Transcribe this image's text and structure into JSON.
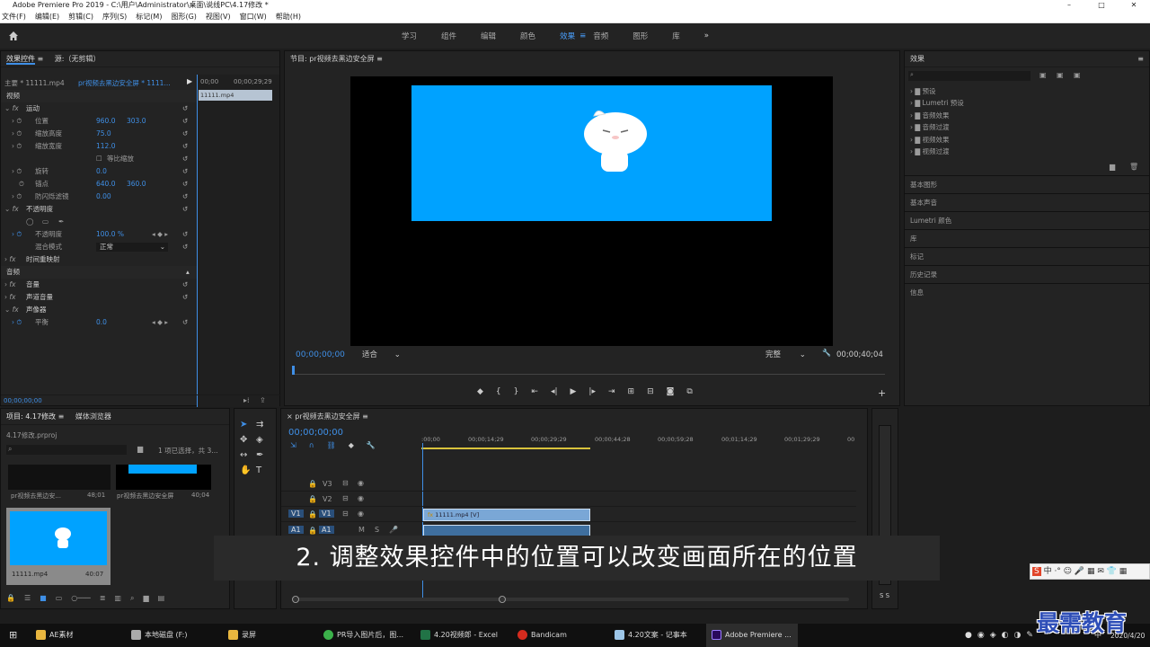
{
  "window": {
    "title": "Adobe Premiere Pro 2019 - C:\\用户\\Administrator\\桌面\\说线PC\\4.17修改 *"
  },
  "menu": [
    "文件(F)",
    "编辑(E)",
    "剪辑(C)",
    "序列(S)",
    "标记(M)",
    "图形(G)",
    "视图(V)",
    "窗口(W)",
    "帮助(H)"
  ],
  "workspaces": [
    "学习",
    "组件",
    "编辑",
    "颜色",
    "效果",
    "音频",
    "图形",
    "库"
  ],
  "active_workspace": "效果",
  "effect_controls": {
    "tab": "效果控件",
    "tab2": "源:（无剪辑）",
    "master": "主要 * 11111.mp4",
    "sequence": "pr视频去黑边安全屏 * 1111...",
    "tl_start": "00;00",
    "tl_end": "00;00;29;29",
    "clip": "11111.mp4",
    "video_header": "视频",
    "motion": "运动",
    "position_label": "位置",
    "position_x": "960.0",
    "position_y": "303.0",
    "scale_h_label": "缩放高度",
    "scale_h": "75.0",
    "scale_w_label": "缩放宽度",
    "scale_w": "112.0",
    "uniform": "等比缩放",
    "rotation_label": "旋转",
    "rotation": "0.0",
    "anchor_label": "锚点",
    "anchor_x": "640.0",
    "anchor_y": "360.0",
    "flicker_label": "防闪烁滤镜",
    "flicker": "0.00",
    "opacity_sec": "不透明度",
    "opacity_label": "不透明度",
    "opacity": "100.0 %",
    "blend_label": "混合模式",
    "blend": "正常",
    "time_remap": "时间重映射",
    "audio_header": "音频",
    "volume": "音量",
    "channel_volume": "声道音量",
    "panner": "声像器",
    "balance_label": "平衡",
    "balance": "0.0",
    "timecode": "00;00;00;00"
  },
  "program": {
    "title": "节目: pr视频去黑边安全屏",
    "timecode": "00;00;00;00",
    "fit": "适合",
    "quality": "完整",
    "duration": "00;00;40;04"
  },
  "effects_panel": {
    "title": "效果",
    "items": [
      "预设",
      "Lumetri 预设",
      "音频效果",
      "音频过渡",
      "视频效果",
      "视频过渡"
    ],
    "sections": [
      "基本图形",
      "基本声音",
      "Lumetri 颜色",
      "库",
      "标记",
      "历史记录",
      "信息"
    ]
  },
  "project": {
    "tab": "项目: 4.17修改",
    "tab2": "媒体浏览器",
    "file": "4.17修改.prproj",
    "selection": "1 项已选择，共 3...",
    "items": [
      {
        "name": "pr视频去黑边安...",
        "dur": "48;01"
      },
      {
        "name": "pr视频去黑边安全屏",
        "dur": "40;04"
      },
      {
        "name": "11111.mp4",
        "dur": "40:07"
      }
    ]
  },
  "timeline": {
    "title": "pr视频去黑边安全屏",
    "timecode": "00;00;00;00",
    "ruler": [
      ":00;00",
      "00;00;14;29",
      "00;00;29;29",
      "00;00;44;28",
      "00;00;59;28",
      "00;01;14;29",
      "00;01;29;29",
      "00"
    ],
    "tracks": [
      "V3",
      "V2",
      "V1",
      "A1"
    ],
    "clip_label": "11111.mp4 [V]"
  },
  "audio_meter": {
    "label": "S S"
  },
  "subtitle": "2. 调整效果控件中的位置可以改变画面所在的位置",
  "watermark": "最需教育",
  "taskbar": {
    "items": [
      "AE素材",
      "本地磁盘 (F:)",
      "录屏",
      "PR导入图片后，图...",
      "4.20视频郎 - Excel",
      "Bandicam",
      "4.20文案 - 记事本",
      "Adobe Premiere ..."
    ],
    "ime": "中",
    "date": "2020/4/20"
  },
  "colors": {
    "accent": "#3f8fe6",
    "preview_bg": "#00a2ff",
    "clip": "#7aa7d6"
  }
}
